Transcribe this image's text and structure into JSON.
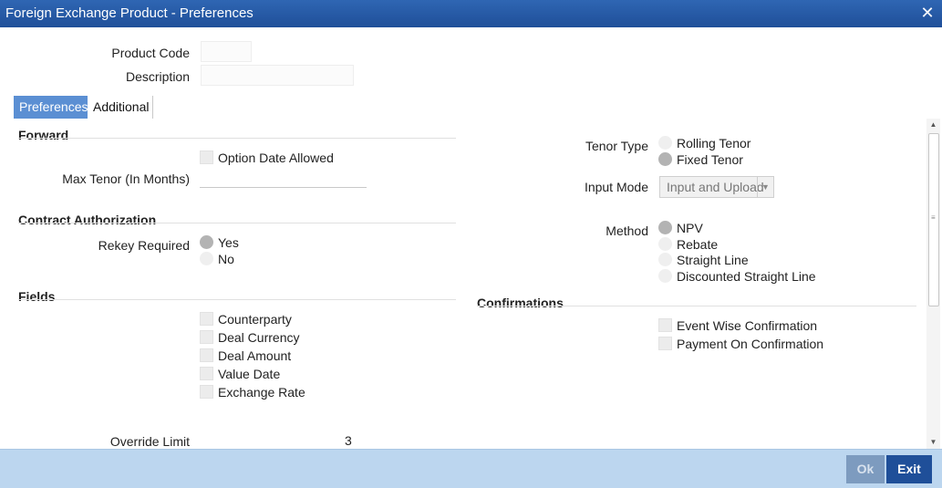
{
  "window": {
    "title": "Foreign Exchange Product - Preferences",
    "close_glyph": "✕"
  },
  "header": {
    "product_code_label": "Product Code",
    "description_label": "Description"
  },
  "tabs": [
    {
      "label": "Preferences",
      "active": true
    },
    {
      "label": "Additional",
      "active": false
    }
  ],
  "forward": {
    "title": "Forward",
    "option_date_allowed": {
      "label": "Option Date Allowed",
      "checked": false
    },
    "max_tenor_label": "Max Tenor (In Months)",
    "max_tenor_value": ""
  },
  "contract_authorization": {
    "title": "Contract Authorization",
    "rekey_label": "Rekey Required",
    "options": [
      {
        "label": "Yes",
        "selected": true
      },
      {
        "label": "No",
        "selected": false
      }
    ]
  },
  "fields": {
    "title": "Fields",
    "items": [
      {
        "label": "Counterparty",
        "checked": false
      },
      {
        "label": "Deal Currency",
        "checked": false
      },
      {
        "label": "Deal Amount",
        "checked": false
      },
      {
        "label": "Value Date",
        "checked": false
      },
      {
        "label": "Exchange Rate",
        "checked": false
      }
    ],
    "override_limit_label": "Override Limit",
    "override_limit_value": "3"
  },
  "tenor": {
    "label": "Tenor Type",
    "options": [
      {
        "label": "Rolling Tenor",
        "selected": false
      },
      {
        "label": "Fixed Tenor",
        "selected": true
      }
    ]
  },
  "input_mode": {
    "label": "Input Mode",
    "value": "Input and Upload",
    "arrow": "▼"
  },
  "method": {
    "label": "Method",
    "options": [
      {
        "label": "NPV",
        "selected": true
      },
      {
        "label": "Rebate",
        "selected": false
      },
      {
        "label": "Straight Line",
        "selected": false
      },
      {
        "label": "Discounted Straight Line",
        "selected": false
      }
    ]
  },
  "confirmations": {
    "title": "Confirmations",
    "items": [
      {
        "label": "Event Wise Confirmation",
        "checked": false
      },
      {
        "label": "Payment On Confirmation",
        "checked": false
      }
    ]
  },
  "scrollbar": {
    "up": "▲",
    "down": "▼",
    "grip": "≡"
  },
  "footer": {
    "ok_label": "Ok",
    "exit_label": "Exit"
  },
  "colors": {
    "titlebar": "#1f4f99",
    "active_tab": "#5b8fd3",
    "footer": "#bcd6ef"
  }
}
